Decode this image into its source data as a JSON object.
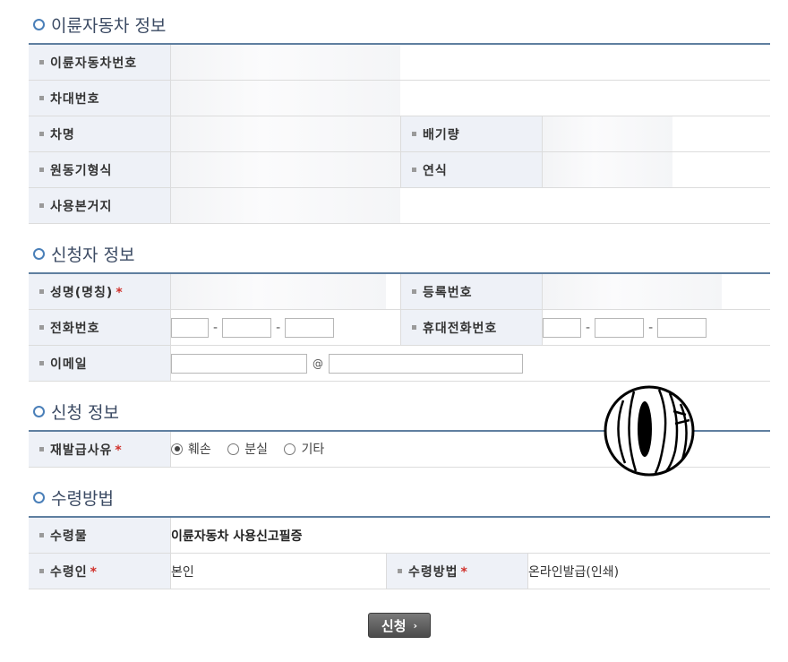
{
  "sections": {
    "vehicle": {
      "title": "이륜자동차 정보",
      "labels": {
        "reg_no": "이륜자동차번호",
        "vin": "차대번호",
        "model": "차명",
        "displacement": "배기량",
        "engine": "원동기형식",
        "year": "연식",
        "address": "사용본거지"
      }
    },
    "applicant": {
      "title": "신청자 정보",
      "labels": {
        "name": "성명(명칭)",
        "id_no": "등록번호",
        "phone": "전화번호",
        "mobile": "휴대전화번호",
        "email": "이메일"
      },
      "at_sign": "@",
      "dash": "-"
    },
    "request": {
      "title": "신청 정보",
      "labels": {
        "reason": "재발급사유"
      },
      "options": [
        "훼손",
        "분실",
        "기타"
      ],
      "selected": "훼손"
    },
    "receive": {
      "title": "수령방법",
      "labels": {
        "item": "수령물",
        "recipient": "수령인",
        "method": "수령방법"
      },
      "values": {
        "item": "이륜자동차 사용신고필증",
        "recipient": "본인",
        "method": "온라인발급(인쇄)"
      }
    }
  },
  "required_mark": "*",
  "submit_label": "신청",
  "submit_arrow": "›"
}
